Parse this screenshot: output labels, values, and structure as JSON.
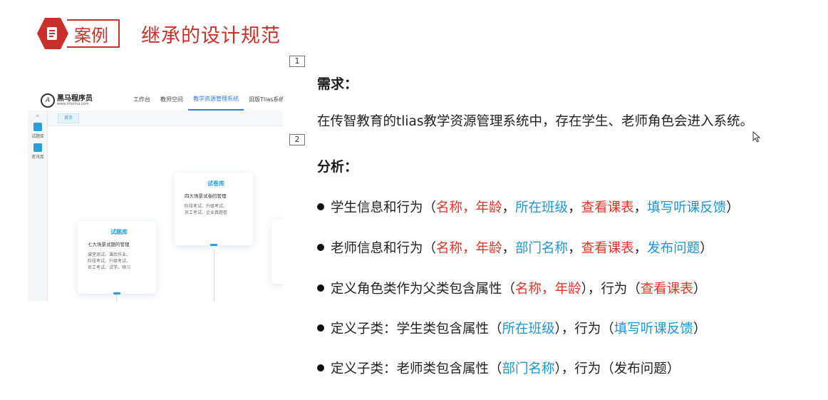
{
  "header": {
    "icon": "document-icon",
    "tag": "案例",
    "title": "继承的设计规范"
  },
  "slide_numbers": [
    "1",
    "2"
  ],
  "screenshot": {
    "logo_mark": "A",
    "logo_text": "黑马程序员",
    "logo_sub": "www.itheima.com",
    "nav": [
      "工作台",
      "教师空间",
      "教学资源管理系统",
      "旧版Tlias系统"
    ],
    "sidebar": [
      {
        "icon": "book-icon",
        "label": "试题库"
      },
      {
        "icon": "chat-icon",
        "label": "资讯库"
      }
    ],
    "sidebar_toggle": "≡",
    "tab_home": "首页",
    "card_papers": {
      "title": "试卷库",
      "subtitle": "四大场景试卷的管理",
      "desc": "阶段考试、升级考试、\n员工考试、企业真题卷"
    },
    "card_questions": {
      "title": "试题库",
      "subtitle": "七大场景试题的管理",
      "desc": "课堂测试、课后作业、\n阶段考试、升级考试、\n员工考试、试学、预习"
    }
  },
  "content": {
    "req_title": "需求：",
    "req_text": "在传智教育的tlias教学资源管理系统中，存在学生、老师角色会进入系统。",
    "ana_title": "分析：",
    "b1": {
      "a": "学生信息和行为（",
      "b": "名称，年龄",
      "c": "，",
      "d": "所在班级",
      "e": "，",
      "f": "查看课表",
      "g": "，",
      "h": "填写听课反馈",
      "i": "）"
    },
    "b2": {
      "a": "老师信息和行为（",
      "b": "名称，年龄",
      "c": "，",
      "d": "部门名称",
      "e": "，",
      "f": "查看课表",
      "g": "，",
      "h": "发布问题",
      "i": "）"
    },
    "b3": {
      "a": "定义角色类作为父类包含属性（",
      "b": "名称，年龄",
      "c": "），行为（",
      "d": "查看课表",
      "e": "）"
    },
    "b4": {
      "a": "定义子类：学生类包含属性（",
      "b": "所在班级",
      "c": "），行为（",
      "d": "填写听课反馈",
      "e": "）"
    },
    "b5": {
      "a": "定义子类：老师类包含属性（",
      "b": "部门名称",
      "c": "），行为（发布问题）"
    }
  },
  "colors": {
    "accent": "#c8312b",
    "red": "#e23428",
    "blue": "#1a96d4"
  }
}
